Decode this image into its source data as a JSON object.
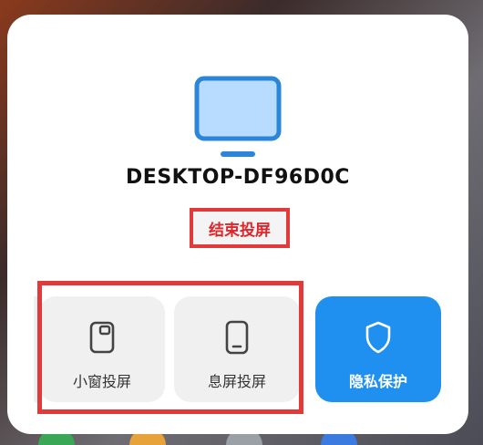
{
  "device": {
    "name": "DESKTOP-DF96D0C",
    "icon": "monitor-icon"
  },
  "actions": {
    "end_cast": "结束投屏"
  },
  "tiles": [
    {
      "label": "小窗投屏",
      "icon": "small-window-icon"
    },
    {
      "label": "息屏投屏",
      "icon": "phone-icon"
    },
    {
      "label": "隐私保护",
      "icon": "shield-icon"
    }
  ],
  "colors": {
    "accent_blue": "#1f8ff0",
    "highlight_red": "#e23a3a",
    "end_text_red": "#e0262a",
    "monitor_fill": "#b7dcff",
    "monitor_stroke": "#2b86d9"
  }
}
